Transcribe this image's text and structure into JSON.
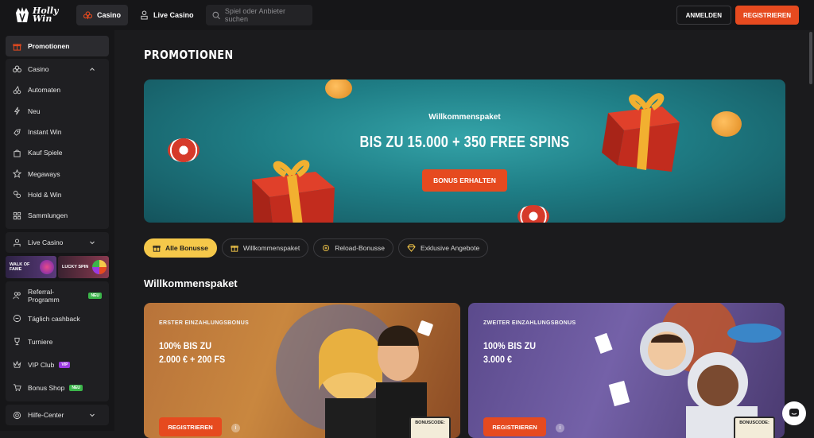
{
  "brand": {
    "line1": "Holly",
    "line2": "Win"
  },
  "topnav": {
    "tabs": [
      {
        "label": "Casino",
        "icon": "club-icon",
        "active": true
      },
      {
        "label": "Live Casino",
        "icon": "dealer-icon",
        "active": false
      }
    ],
    "search_placeholder": "Spiel oder Anbieter suchen",
    "login_label": "ANMELDEN",
    "register_label": "REGISTRIEREN"
  },
  "sidebar": {
    "promotions": "Promotionen",
    "casino": {
      "label": "Casino",
      "items": [
        "Automaten",
        "Neu",
        "Instant Win",
        "Kauf Spiele",
        "Megaways",
        "Hold & Win",
        "Sammlungen"
      ]
    },
    "live_casino": "Live Casino",
    "tiles": [
      {
        "label": "WALK OF FAME"
      },
      {
        "label": "LUCKY SPIN"
      }
    ],
    "extras": [
      {
        "label": "Referral-Programm",
        "badge": "NEU",
        "badge_type": "new"
      },
      {
        "label": "Täglich cashback",
        "badge": "",
        "badge_type": ""
      },
      {
        "label": "Turniere",
        "badge": "",
        "badge_type": ""
      },
      {
        "label": "VIP Club",
        "badge": "VIP",
        "badge_type": "vip"
      },
      {
        "label": "Bonus Shop",
        "badge": "NEU",
        "badge_type": "new"
      }
    ],
    "help": "Hilfe-Center"
  },
  "main": {
    "title": "PROMOTIONEN",
    "hero": {
      "subtitle": "Willkommenspaket",
      "title": "BIS ZU 15.000 + 350 FREE SPINS",
      "button": "BONUS ERHALTEN"
    },
    "filters": [
      {
        "label": "Alle Bonusse",
        "active": true
      },
      {
        "label": "Willkommenspaket",
        "active": false
      },
      {
        "label": "Reload-Bonusse",
        "active": false
      },
      {
        "label": "Exklusive Angebote",
        "active": false
      }
    ],
    "section_title": "Willkommenspaket",
    "cards": [
      {
        "label": "ERSTER EINZAHLUNGSBONUS",
        "title_line1": "100% BIS ZU",
        "title_line2": "2.000 € + 200 FS",
        "button": "REGISTRIEREN",
        "code_label": "BONUSCODE:"
      },
      {
        "label": "ZWEITER EINZAHLUNGSBONUS",
        "title_line1": "100% BIS ZU",
        "title_line2": "3.000 €",
        "button": "REGISTRIEREN",
        "code_label": "BONUSCODE:"
      }
    ]
  },
  "colors": {
    "accent": "#e64a1f",
    "chip_active": "#f5c84a",
    "hero": "#1f7e86"
  }
}
